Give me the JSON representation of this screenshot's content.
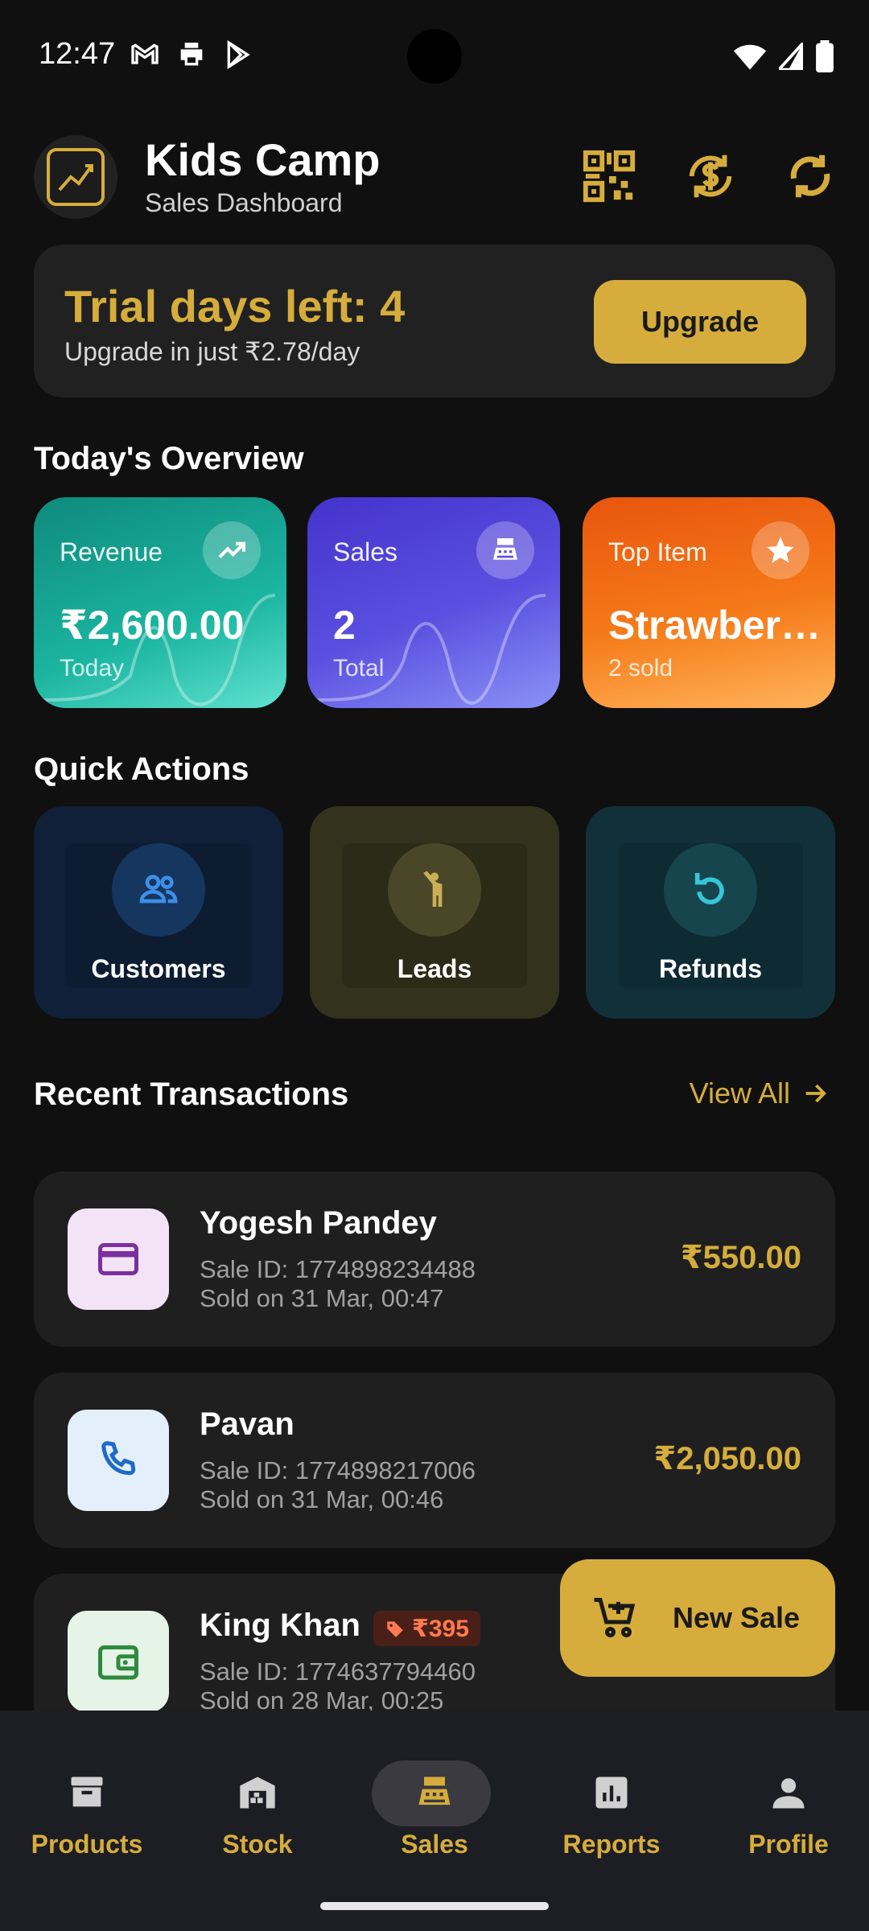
{
  "status": {
    "time": "12:47",
    "left_icons": [
      "gmail-icon",
      "print-icon",
      "play-store-icon"
    ],
    "right_icons": [
      "wifi-icon",
      "signal-icon",
      "battery-icon"
    ]
  },
  "header": {
    "title": "Kids Camp",
    "subtitle": "Sales Dashboard",
    "buttons": [
      "qr-scan-icon",
      "currency-exchange-icon",
      "sync-icon"
    ]
  },
  "trial": {
    "title": "Trial days left: 4",
    "subtitle": "Upgrade in just ₹2.78/day",
    "button_label": "Upgrade"
  },
  "overview": {
    "title": "Today's Overview",
    "cards": [
      {
        "label": "Revenue",
        "value": "₹2,600.00",
        "sub": "Today",
        "icon": "trending-up-icon"
      },
      {
        "label": "Sales",
        "value": "2",
        "sub": "Total",
        "icon": "cash-register-icon"
      },
      {
        "label": "Top Item",
        "value": "Strawber…",
        "sub": "2 sold",
        "icon": "star-icon"
      }
    ]
  },
  "quick_actions": {
    "title": "Quick Actions",
    "items": [
      {
        "label": "Customers",
        "icon": "people-icon"
      },
      {
        "label": "Leads",
        "icon": "person-raising-hand-icon"
      },
      {
        "label": "Refunds",
        "icon": "refresh-icon"
      }
    ]
  },
  "recent": {
    "title": "Recent Transactions",
    "view_all": "View All",
    "transactions": [
      {
        "name": "Yogesh Pandey",
        "sale_id": "Sale ID: 1774898234488",
        "date": "Sold on 31 Mar, 00:47",
        "amount": "₹550.00",
        "icon": "credit-card-icon",
        "badge": ""
      },
      {
        "name": "Pavan",
        "sale_id": "Sale ID: 1774898217006",
        "date": "Sold on 31 Mar, 00:46",
        "amount": "₹2,050.00",
        "icon": "phone-icon",
        "badge": ""
      },
      {
        "name": "King Khan",
        "sale_id": "Sale ID: 1774637794460",
        "date": "Sold on 28 Mar, 00:25",
        "amount": "",
        "icon": "wallet-icon",
        "badge": "₹395"
      }
    ]
  },
  "fab": {
    "label": "New Sale",
    "icon": "add-shopping-cart-icon"
  },
  "nav": {
    "items": [
      {
        "label": "Products",
        "icon": "archive-icon"
      },
      {
        "label": "Stock",
        "icon": "warehouse-icon"
      },
      {
        "label": "Sales",
        "icon": "cash-register-icon"
      },
      {
        "label": "Reports",
        "icon": "bar-chart-icon"
      },
      {
        "label": "Profile",
        "icon": "person-icon"
      }
    ],
    "active_index": 2
  },
  "colors": {
    "accent": "#d6ad3c",
    "background": "#101010",
    "card": "#1f1f1f"
  }
}
